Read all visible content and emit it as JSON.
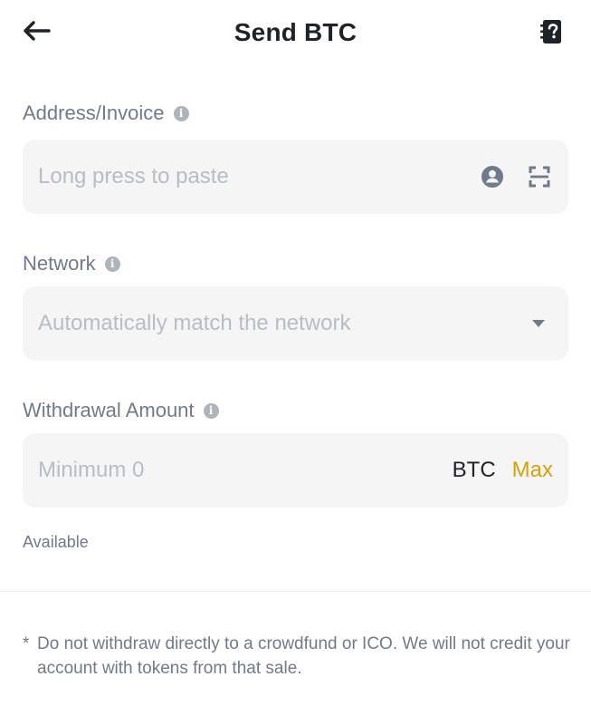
{
  "header": {
    "title": "Send BTC"
  },
  "address": {
    "label": "Address/Invoice",
    "placeholder": "Long press to paste"
  },
  "network": {
    "label": "Network",
    "placeholder": "Automatically match the network"
  },
  "amount": {
    "label": "Withdrawal Amount",
    "placeholder": "Minimum 0",
    "unit": "BTC",
    "max_label": "Max"
  },
  "available": {
    "label": "Available"
  },
  "note": {
    "marker": "*",
    "text": "Do not withdraw directly to a crowdfund or ICO. We will not credit your account with tokens from that sale."
  },
  "colors": {
    "accent": "#d4a10a",
    "field_bg": "#f5f5f5",
    "label": "#707a8a",
    "placeholder": "#b7bdc6"
  },
  "icons": {
    "back": "arrow-left-icon",
    "help": "help-document-icon",
    "info": "info-icon",
    "contact": "contact-icon",
    "scan": "scan-icon",
    "dropdown": "caret-down-icon"
  }
}
